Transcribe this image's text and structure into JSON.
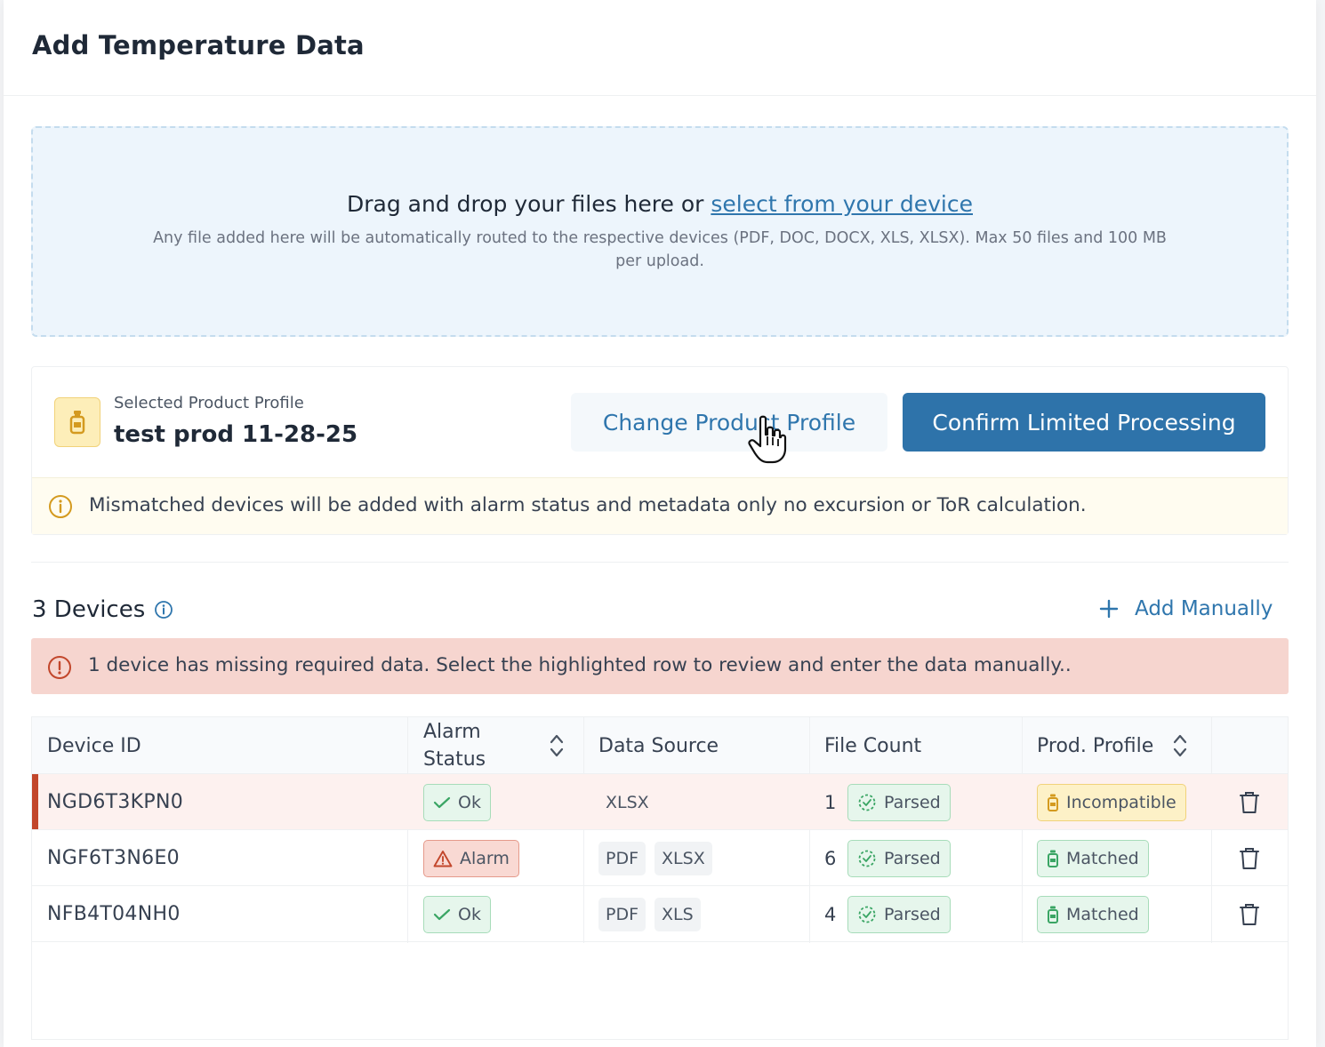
{
  "page": {
    "title": "Add Temperature Data"
  },
  "upload": {
    "title_prefix": "Drag and drop your files here or ",
    "link_text": "select from your device",
    "subtitle": "Any file added here will be automatically routed to the respective devices (PDF, DOC, DOCX, XLS, XLSX). Max 50 files and 100 MB per upload."
  },
  "profile": {
    "label": "Selected Product Profile",
    "value": "test prod 11-28-25",
    "change_button": "Change Product Profile",
    "confirm_button": "Confirm Limited Processing",
    "notice": "Mismatched devices will be added with alarm status and metadata only no excursion or ToR calculation."
  },
  "devices": {
    "title": "3 Devices",
    "add_manually": "Add Manually",
    "error": "1 device has missing required data. Select the highlighted row to review and enter the data manually..",
    "columns": {
      "device_id": "Device ID",
      "alarm_status_1": "Alarm",
      "alarm_status_2": "Status",
      "data_source": "Data Source",
      "file_count": "File Count",
      "prod_profile": "Prod. Profile"
    },
    "rows": [
      {
        "id": "NGD6T3KPN0",
        "alarm": "Ok",
        "sources": [
          "XLSX"
        ],
        "count": "1",
        "parse": "Parsed",
        "profile": "Incompatible"
      },
      {
        "id": "NGF6T3N6E0",
        "alarm": "Alarm",
        "sources": [
          "PDF",
          "XLSX"
        ],
        "count": "6",
        "parse": "Parsed",
        "profile": "Matched"
      },
      {
        "id": "NFB4T04NH0",
        "alarm": "Ok",
        "sources": [
          "PDF",
          "XLS"
        ],
        "count": "4",
        "parse": "Parsed",
        "profile": "Matched"
      }
    ]
  },
  "colors": {
    "accent": "#2e73aa",
    "link": "#2f76ad",
    "error_bg": "#f6d5cf",
    "highlight_bar": "#c2462b",
    "ok_green": "#3aa564"
  },
  "icons": {
    "bottle": "bottle-icon",
    "info": "info-circle-icon",
    "plus": "plus-icon",
    "sort": "sort-icon",
    "check": "check-icon",
    "warning": "warning-triangle-icon",
    "parsed": "dashed-check-circle-icon",
    "trash": "trash-icon",
    "cursor": "hand-pointer-icon"
  }
}
